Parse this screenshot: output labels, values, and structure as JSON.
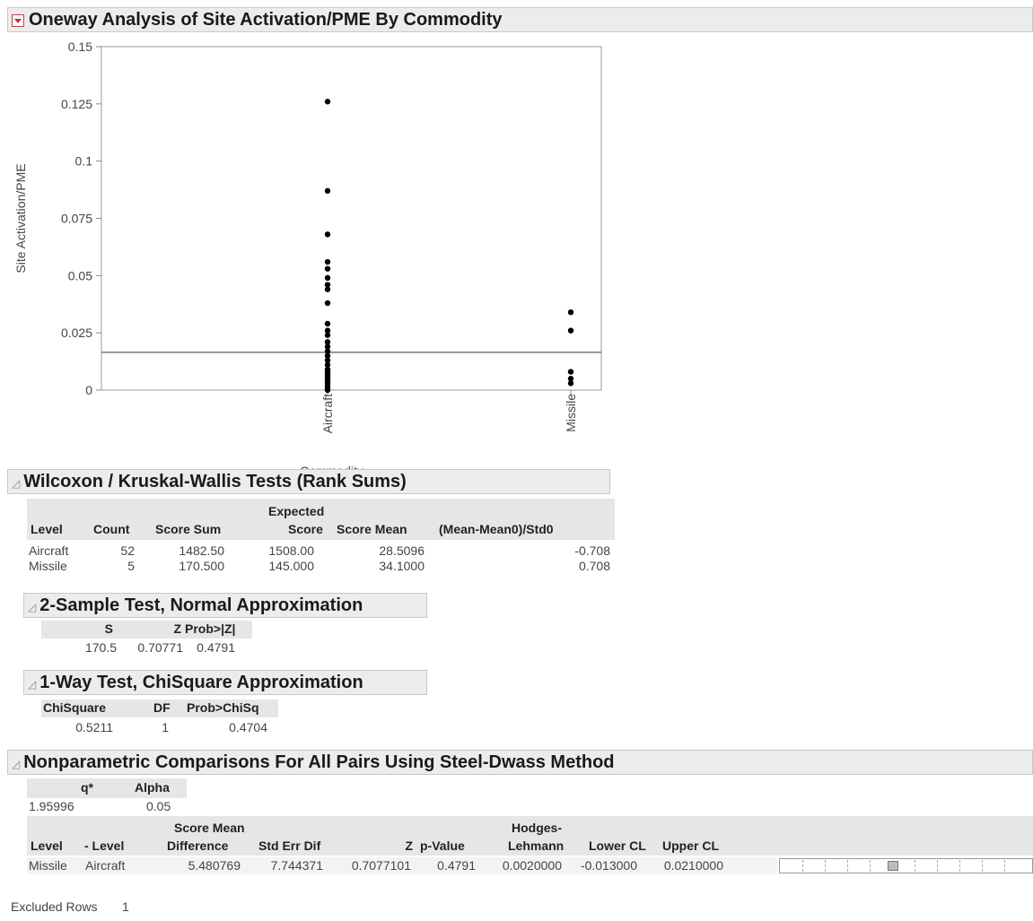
{
  "report": {
    "title": "Oneway Analysis of Site Activation/PME By Commodity",
    "excluded_rows_label": "Excluded Rows",
    "excluded_rows_value": "1"
  },
  "chart_data": {
    "type": "scatter",
    "xlabel": "Commodity",
    "ylabel": "Site Activation/PME",
    "categories": [
      "Aircraft",
      "Missile"
    ],
    "ylim": [
      0,
      0.15
    ],
    "yticks": [
      "0",
      "0.025",
      "0.05",
      "0.075",
      "0.1",
      "0.125",
      "0.15"
    ],
    "reference_line": 0.0165,
    "series": [
      {
        "category": "Aircraft",
        "values": [
          0.126,
          0.087,
          0.068,
          0.056,
          0.053,
          0.049,
          0.046,
          0.044,
          0.038,
          0.029,
          0.026,
          0.024,
          0.021,
          0.019,
          0.017,
          0.015,
          0.013,
          0.011,
          0.009,
          0.008,
          0.007,
          0.006,
          0.005,
          0.004,
          0.003,
          0.002,
          0.001,
          0.0
        ]
      },
      {
        "category": "Missile",
        "values": [
          0.034,
          0.026,
          0.008,
          0.005,
          0.003
        ]
      }
    ]
  },
  "wilcoxon": {
    "title": "Wilcoxon / Kruskal-Wallis Tests (Rank Sums)",
    "headers": [
      "Level",
      "Count",
      "Score Sum",
      "Expected",
      "Score",
      "Score Mean",
      "(Mean-Mean0)/Std0"
    ],
    "rows": [
      [
        "Aircraft",
        "52",
        "1482.50",
        "1508.00",
        "28.5096",
        "-0.708"
      ],
      [
        "Missile",
        "5",
        "170.500",
        "145.000",
        "34.1000",
        "0.708"
      ]
    ]
  },
  "two_sample": {
    "title": "2-Sample Test, Normal Approximation",
    "headers": [
      "S",
      "Z",
      "Prob>|Z|"
    ],
    "values": [
      "170.5",
      "0.70771",
      "0.4791"
    ]
  },
  "one_way": {
    "title": "1-Way Test, ChiSquare Approximation",
    "headers": [
      "ChiSquare",
      "DF",
      "Prob>ChiSq"
    ],
    "values": [
      "0.5211",
      "1",
      "0.4704"
    ]
  },
  "nonparam": {
    "title": "Nonparametric Comparisons For All Pairs Using Steel-Dwass  Method",
    "q_headers": [
      "q*",
      "Alpha"
    ],
    "q_values": [
      "1.95996",
      "0.05"
    ],
    "headers": [
      "Level",
      "- Level",
      "Score Mean",
      "Difference",
      "Std Err Dif",
      "Z",
      "p-Value",
      "Hodges-",
      "Lehmann",
      "Lower CL",
      "Upper CL"
    ],
    "row": [
      "Missile",
      "Aircraft",
      "5.480769",
      "7.744371",
      "0.7077101",
      "0.4791",
      "0.0020000",
      "-0.013000",
      "0.0210000"
    ],
    "p_value_fraction": 0.4791
  }
}
